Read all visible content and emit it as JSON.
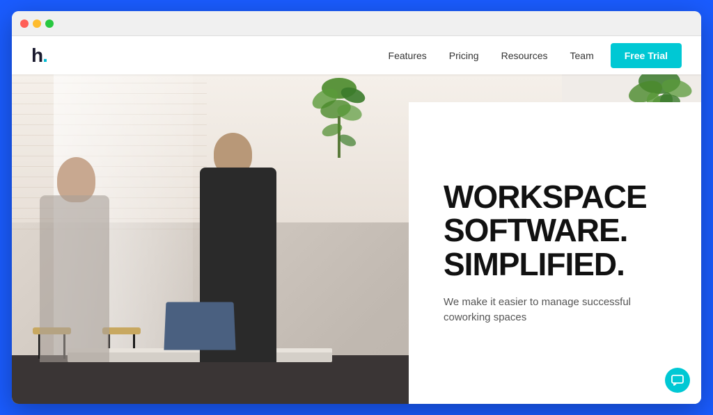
{
  "browser": {
    "traffic_lights": [
      "red",
      "yellow",
      "green"
    ]
  },
  "navbar": {
    "logo": "h.",
    "nav_items": [
      {
        "label": "Features",
        "id": "features"
      },
      {
        "label": "Pricing",
        "id": "pricing"
      },
      {
        "label": "Resources",
        "id": "resources"
      },
      {
        "label": "Team",
        "id": "team"
      }
    ],
    "cta_label": "Free Trial"
  },
  "hero": {
    "title_line1": "WORKSPACE",
    "title_line2": "SOFTWARE.",
    "title_line3": "SIMPLIFIED.",
    "subtitle": "We make it easier to manage successful coworking spaces"
  },
  "colors": {
    "accent": "#00c8d4",
    "brand_blue": "#1a5cff",
    "text_dark": "#111111",
    "text_muted": "#555555"
  }
}
